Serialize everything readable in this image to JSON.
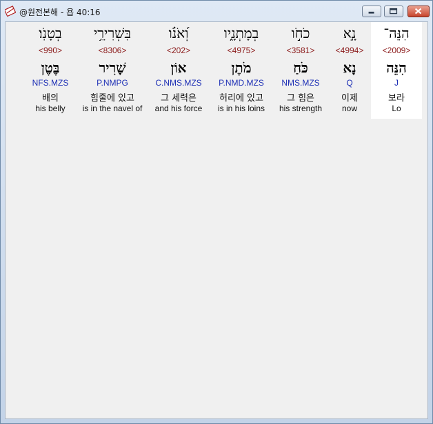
{
  "window": {
    "title": "@원전본해 - 욥 40:16"
  },
  "words": [
    {
      "hebrew": "בְטָנֹֽו׃",
      "strong": "<990>",
      "lemma": "בֶּטֶן",
      "parse": "NFS.MZS",
      "korean": "배의",
      "english": "his belly"
    },
    {
      "hebrew": "בִּשְׁרִירֵ֥י",
      "strong": "<8306>",
      "lemma": "שָׁרִיר",
      "parse": "P.NMPG",
      "korean": "힘줄에 있고",
      "english": "is in the navel of"
    },
    {
      "hebrew": "וְ֝אֹנֹ֗ו",
      "strong": "<202>",
      "lemma": "אוֹן",
      "parse": "C.NMS.MZS",
      "korean": "그 세력은",
      "english": "and his force"
    },
    {
      "hebrew": "בְמָתְנָ֑יו",
      "strong": "<4975>",
      "lemma": "מֹתֶן",
      "parse": "P.NMD.MZS",
      "korean": "허리에 있고",
      "english": "is in his loins"
    },
    {
      "hebrew": "כֹחֹ֣ו",
      "strong": "<3581>",
      "lemma": "כֹּחַ",
      "parse": "NMS.MZS",
      "korean": "그 힘은",
      "english": "his strength"
    },
    {
      "hebrew": "נָ֣א",
      "strong": "<4994>",
      "lemma": "נָא",
      "parse": "Q",
      "korean": "이제",
      "english": "now"
    },
    {
      "hebrew": "הִנֵּה־",
      "strong": "<2009>",
      "lemma": "הִנֵּה",
      "parse": "J",
      "korean": "보라",
      "english": "Lo"
    }
  ]
}
